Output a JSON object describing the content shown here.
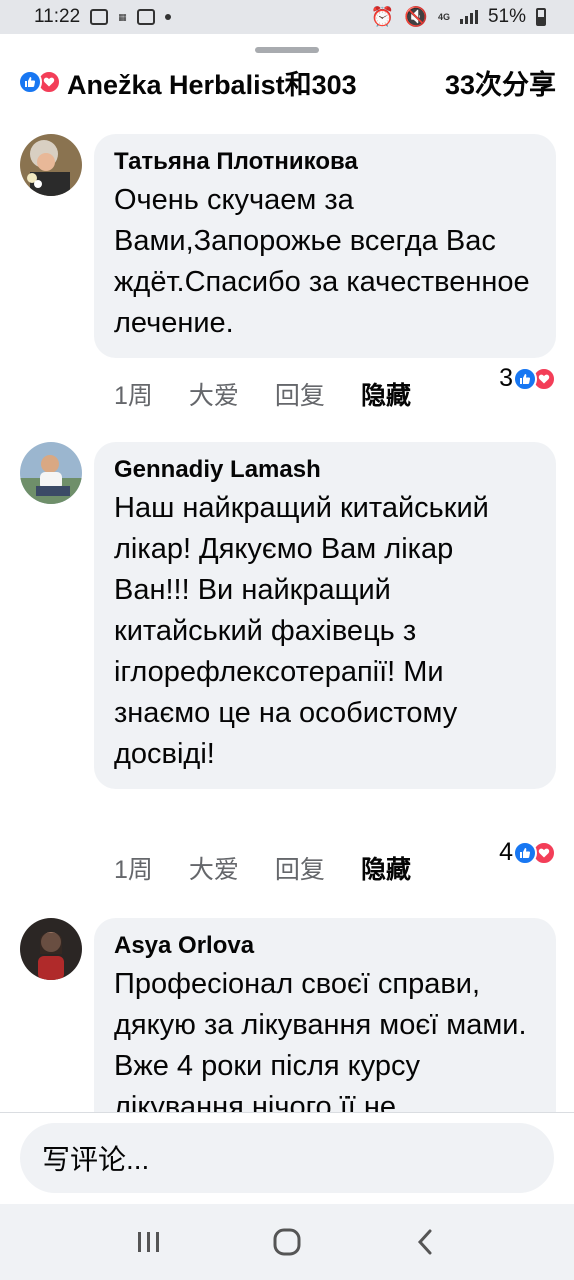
{
  "status_bar": {
    "time": "11:22",
    "network": "4G",
    "battery": "51%"
  },
  "header": {
    "reactors": "Anežka Herbalist和303",
    "shares": "33次分享",
    "icons": [
      "like-icon",
      "love-icon"
    ]
  },
  "comments": [
    {
      "author": "Татьяна Плотникова",
      "text": "Очень скучаем за Вами,Запорожье всегда Вас ждёт.Спасибо за качественное лечение.",
      "time": "1周",
      "love_label": "大爱",
      "reply_label": "回复",
      "hide_label": "隐藏",
      "reaction_count": "3"
    },
    {
      "author": "Gennadiy Lamash",
      "text": "Наш найкращий китайський лікар! Дякуємо Вам лікар Ван!!! Ви найкращий китайський фахівець з іглорефлексотерапії! Ми знаємо це на особистому досвіді!",
      "time": "1周",
      "love_label": "大爱",
      "reply_label": "回复",
      "hide_label": "隐藏",
      "reaction_count": "4"
    },
    {
      "author": "Asya Orlova",
      "text": "Професіонал своєї справи, дякую за лікування моєї мами. Вже 4 роки після курсу лікування нічого її не"
    }
  ],
  "composer": {
    "placeholder": "写评论..."
  },
  "colors": {
    "like": "#1877f2",
    "love": "#f33e58",
    "bubble": "#f0f2f5",
    "secondary_text": "#65676b"
  }
}
